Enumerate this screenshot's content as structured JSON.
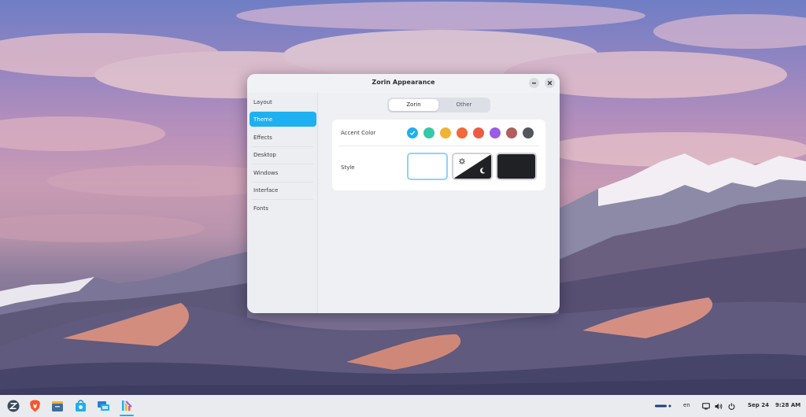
{
  "window": {
    "title": "Zorin Appearance"
  },
  "sidebar": {
    "items": [
      {
        "label": "Layout"
      },
      {
        "label": "Theme",
        "active": true
      },
      {
        "label": "Effects"
      },
      {
        "label": "Desktop"
      },
      {
        "label": "Windows"
      },
      {
        "label": "Interface"
      },
      {
        "label": "Fonts"
      }
    ]
  },
  "tabs": [
    {
      "label": "Zorin",
      "active": true
    },
    {
      "label": "Other"
    }
  ],
  "theme": {
    "accent_label": "Accent Color",
    "style_label": "Style",
    "accent_colors": [
      "#1eb0f0",
      "#35c8a5",
      "#f2b233",
      "#f06a3a",
      "#ee5b45",
      "#9a5ce6",
      "#b05e5e",
      "#55565c"
    ],
    "selected_accent": "#1eb0f0",
    "styles": [
      "light",
      "auto",
      "dark"
    ],
    "selected_style": "light"
  },
  "taskbar": {
    "apps": [
      "zorin-menu-icon",
      "brave-browser-icon",
      "files-icon",
      "software-store-icon",
      "zorin-connect-icon",
      "zorin-appearance-icon"
    ],
    "keyboard_layout": "en",
    "date": "Sep 24",
    "time": "9:28 AM"
  },
  "colors": {
    "accent": "#1eb0f0",
    "window_bg": "#eef0f4",
    "panel_bg": "#ffffff"
  }
}
